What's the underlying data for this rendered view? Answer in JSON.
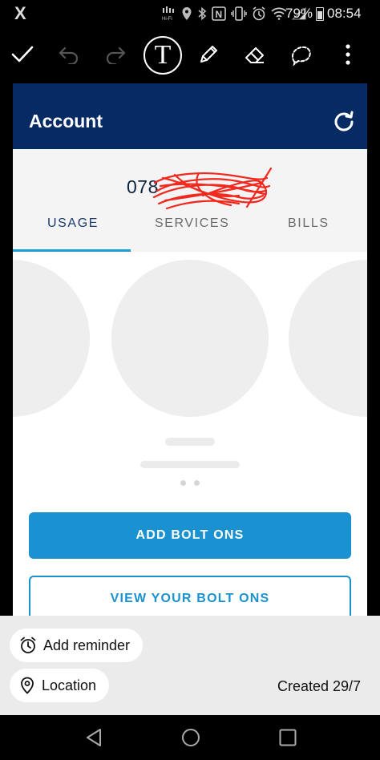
{
  "status_bar": {
    "carrier_icon": "x-logo-icon",
    "battery_percent": "79%",
    "time": "08:54",
    "icons": [
      "hifi-icon",
      "location-icon",
      "bluetooth-icon",
      "nfc-icon",
      "vibrate-icon",
      "alarm-icon",
      "wifi-icon",
      "signal-icon",
      "battery-icon"
    ]
  },
  "editor_toolbar": {
    "tools": [
      "confirm-icon",
      "undo-icon",
      "redo-icon",
      "text-tool-icon",
      "pencil-icon",
      "eraser-icon",
      "lasso-icon",
      "more-icon"
    ],
    "text_tool_glyph": "T"
  },
  "app": {
    "title": "Account",
    "phone_number_visible": "078",
    "tabs": [
      {
        "label": "USAGE",
        "active": true
      },
      {
        "label": "SERVICES",
        "active": false
      },
      {
        "label": "BILLS",
        "active": false
      }
    ],
    "primary_button": "ADD BOLT ONS",
    "secondary_button": "VIEW YOUR BOLT ONS",
    "colors": {
      "app_bar": "#062b64",
      "accent": "#1a91d0"
    }
  },
  "bottom_sheet": {
    "reminder_label": "Add reminder",
    "location_label": "Location",
    "created_label": "Created 29/7"
  },
  "nav_bar": {
    "buttons": [
      "back-icon",
      "home-icon",
      "recents-icon"
    ]
  }
}
